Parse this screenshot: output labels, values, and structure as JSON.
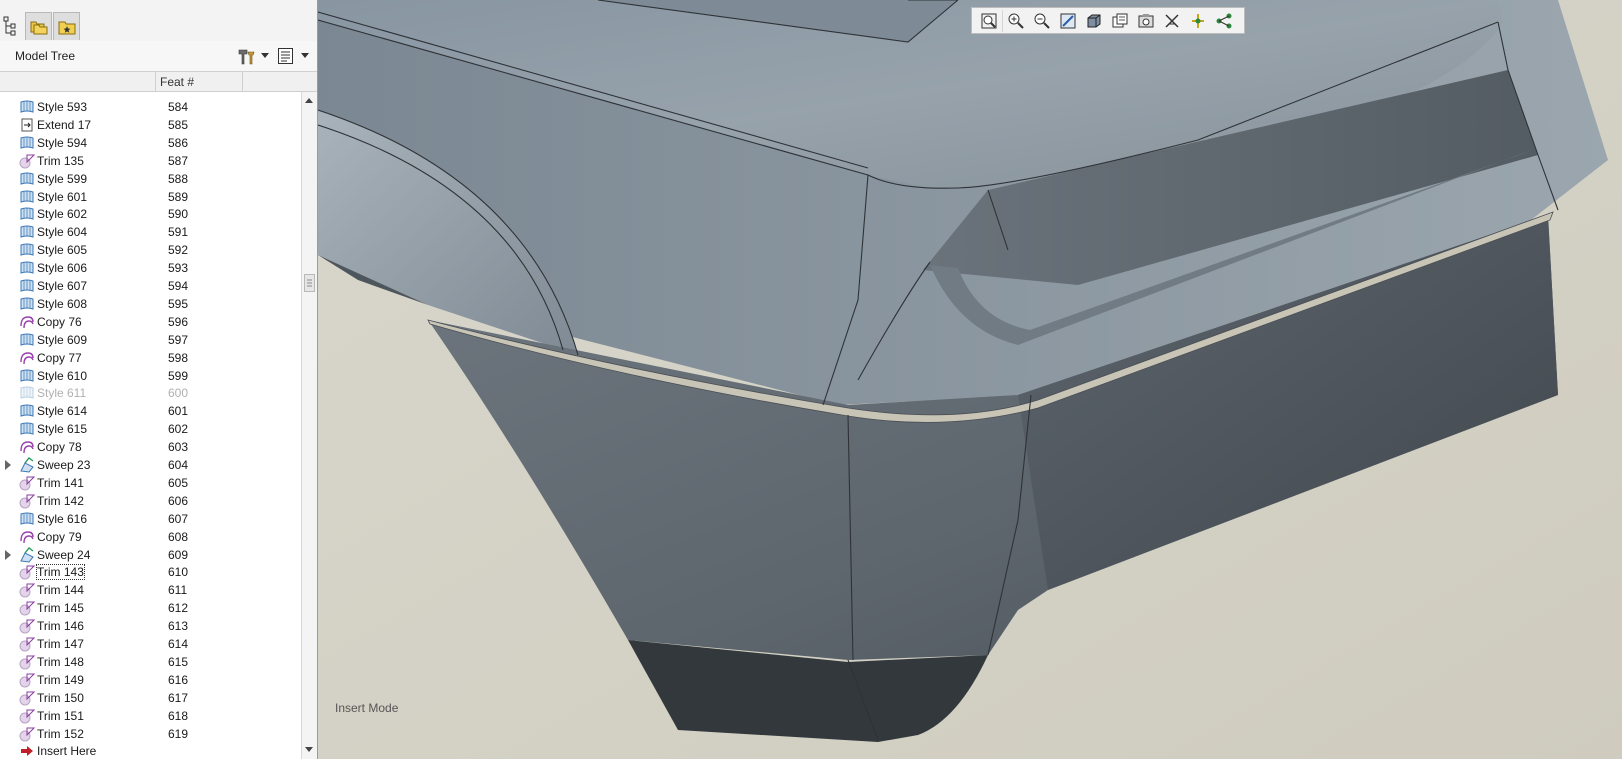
{
  "model_tree": {
    "title": "Model Tree",
    "column_feat": "Feat #",
    "rows": [
      {
        "name": "Style 593",
        "num": "584",
        "icon": "style-surface-icon"
      },
      {
        "name": "Extend 17",
        "num": "585",
        "icon": "extend-icon"
      },
      {
        "name": "Style 594",
        "num": "586",
        "icon": "style-surface-icon"
      },
      {
        "name": "Trim 135",
        "num": "587",
        "icon": "trim-icon"
      },
      {
        "name": "Style 599",
        "num": "588",
        "icon": "style-surface-icon"
      },
      {
        "name": "Style 601",
        "num": "589",
        "icon": "style-surface-icon"
      },
      {
        "name": "Style 602",
        "num": "590",
        "icon": "style-surface-icon"
      },
      {
        "name": "Style 604",
        "num": "591",
        "icon": "style-surface-icon"
      },
      {
        "name": "Style 605",
        "num": "592",
        "icon": "style-surface-icon"
      },
      {
        "name": "Style 606",
        "num": "593",
        "icon": "style-surface-icon"
      },
      {
        "name": "Style 607",
        "num": "594",
        "icon": "style-surface-icon"
      },
      {
        "name": "Style 608",
        "num": "595",
        "icon": "style-surface-icon"
      },
      {
        "name": "Copy 76",
        "num": "596",
        "icon": "copy-icon"
      },
      {
        "name": "Style 609",
        "num": "597",
        "icon": "style-surface-icon"
      },
      {
        "name": "Copy 77",
        "num": "598",
        "icon": "copy-icon"
      },
      {
        "name": "Style 610",
        "num": "599",
        "icon": "style-surface-icon"
      },
      {
        "name": "Style 611",
        "num": "600",
        "icon": "style-surface-icon",
        "suppressed": true
      },
      {
        "name": "Style 614",
        "num": "601",
        "icon": "style-surface-icon"
      },
      {
        "name": "Style 615",
        "num": "602",
        "icon": "style-surface-icon"
      },
      {
        "name": "Copy 78",
        "num": "603",
        "icon": "copy-icon"
      },
      {
        "name": "Sweep 23",
        "num": "604",
        "icon": "sweep-icon",
        "expandable": true
      },
      {
        "name": "Trim 141",
        "num": "605",
        "icon": "trim-icon"
      },
      {
        "name": "Trim 142",
        "num": "606",
        "icon": "trim-icon"
      },
      {
        "name": "Style 616",
        "num": "607",
        "icon": "style-surface-icon"
      },
      {
        "name": "Copy 79",
        "num": "608",
        "icon": "copy-icon"
      },
      {
        "name": "Sweep 24",
        "num": "609",
        "icon": "sweep-icon",
        "expandable": true
      },
      {
        "name": "Trim 143",
        "num": "610",
        "icon": "trim-icon",
        "selected": true
      },
      {
        "name": "Trim 144",
        "num": "611",
        "icon": "trim-icon"
      },
      {
        "name": "Trim 145",
        "num": "612",
        "icon": "trim-icon"
      },
      {
        "name": "Trim 146",
        "num": "613",
        "icon": "trim-icon"
      },
      {
        "name": "Trim 147",
        "num": "614",
        "icon": "trim-icon"
      },
      {
        "name": "Trim 148",
        "num": "615",
        "icon": "trim-icon"
      },
      {
        "name": "Trim 149",
        "num": "616",
        "icon": "trim-icon"
      },
      {
        "name": "Trim 150",
        "num": "617",
        "icon": "trim-icon"
      },
      {
        "name": "Trim 151",
        "num": "618",
        "icon": "trim-icon"
      },
      {
        "name": "Trim 152",
        "num": "619",
        "icon": "trim-icon"
      },
      {
        "name": "Insert Here",
        "num": "",
        "icon": "insert-arrow-icon"
      }
    ]
  },
  "tabs": [
    {
      "id": "model-tree",
      "icon": "tree-icon"
    },
    {
      "id": "folder-browser",
      "icon": "folders-icon"
    },
    {
      "id": "favorites",
      "icon": "favorites-icon"
    }
  ],
  "view_toolbar": [
    {
      "name": "refit-button",
      "icon": "refit-icon"
    },
    {
      "name": "zoom-in-button",
      "icon": "zoom-in-icon"
    },
    {
      "name": "zoom-out-button",
      "icon": "zoom-out-icon"
    },
    {
      "name": "repaint-button",
      "icon": "repaint-icon"
    },
    {
      "name": "display-style-button",
      "icon": "display-style-icon"
    },
    {
      "name": "saved-views-button",
      "icon": "saved-views-icon"
    },
    {
      "name": "view-manager-button",
      "icon": "view-manager-icon"
    },
    {
      "name": "datum-display-button",
      "icon": "datum-display-icon"
    },
    {
      "name": "spin-center-button",
      "icon": "spin-center-icon"
    },
    {
      "name": "annotation-display-button",
      "icon": "annotation-display-icon"
    }
  ],
  "status": {
    "mode": "Insert Mode"
  },
  "colors": {
    "surface_light": "#8e99a3",
    "surface_dark": "#3a3f45",
    "background": "#d6d3c6",
    "style_icon": "#3a78b6",
    "copy_icon": "#9a3fb0",
    "insert_arrow": "#c0202a"
  }
}
